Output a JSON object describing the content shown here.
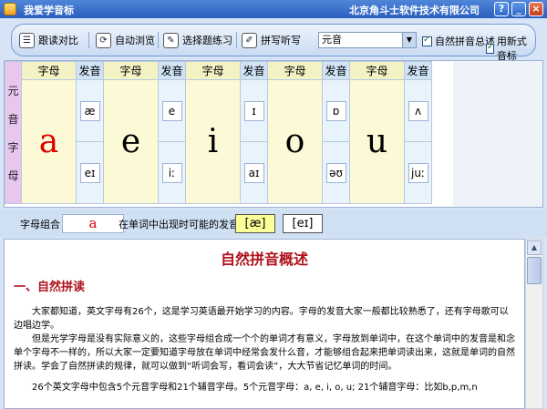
{
  "window": {
    "title": "我爱学音标",
    "company": "北京角斗士软件技术有限公司",
    "help_label": "?",
    "minimize_label": "_",
    "close_label": "×"
  },
  "toolbar": {
    "buttons": [
      {
        "label": "跟读对比",
        "icon": "read-along-icon",
        "glyph": "☰"
      },
      {
        "label": "自动浏览",
        "icon": "auto-browse-icon",
        "glyph": "⟳"
      },
      {
        "label": "选择题练习",
        "icon": "quiz-icon",
        "glyph": "✎"
      },
      {
        "label": "拼写听写",
        "icon": "dictation-icon",
        "glyph": "✐"
      }
    ],
    "category_select": {
      "value": "元音",
      "arrow": "▼"
    },
    "checkboxes": [
      {
        "label": "自然拼音总述",
        "checked": true
      },
      {
        "label": "用新式音标",
        "checked": true
      }
    ]
  },
  "grid": {
    "side_label": [
      "元",
      "音",
      "字",
      "母"
    ],
    "header_letter": "字母",
    "header_sound": "发音",
    "columns": [
      {
        "letter": "a",
        "sounds": [
          "æ",
          "eɪ"
        ]
      },
      {
        "letter": "e",
        "sounds": [
          "e",
          "iː"
        ]
      },
      {
        "letter": "i",
        "sounds": [
          "ɪ",
          "aɪ"
        ]
      },
      {
        "letter": "o",
        "sounds": [
          "ɒ",
          "əʊ"
        ]
      },
      {
        "letter": "u",
        "sounds": [
          "ʌ",
          "juː"
        ]
      }
    ]
  },
  "combo": {
    "label": "字母组合",
    "value": "a",
    "hint": "在单词中出现时可能的发音:",
    "sounds": [
      "[æ]",
      "[eɪ]"
    ]
  },
  "article": {
    "title": "自然拼音概述",
    "section_heading": "一、自然拼读",
    "paragraphs": [
      "大家都知道，英文字母有26个，这是学习英语最开始学习的内容。字母的发音大家一般都比较熟悉了，还有字母歌可以边唱边学。",
      "但是光学字母是没有实际意义的，这些字母组合成一个个的单词才有意义，字母放到单词中，在这个单词中的发音是和念单个字母不一样的，所以大家一定要知道字母放在单词中经常会发什么音，才能够组合起来把单词读出来，这就是单词的自然拼读。学会了自然拼读的规律，就可以做到“听词会写，看词会读”，大大节省记忆单词的时间。",
      "26个英文字母中包含5个元音字母和21个辅音字母。5个元音字母：a, e, i, o, u; 21个辅音字母：比如b,p,m,n"
    ]
  },
  "scrollbar": {
    "up_arrow": "▲"
  }
}
